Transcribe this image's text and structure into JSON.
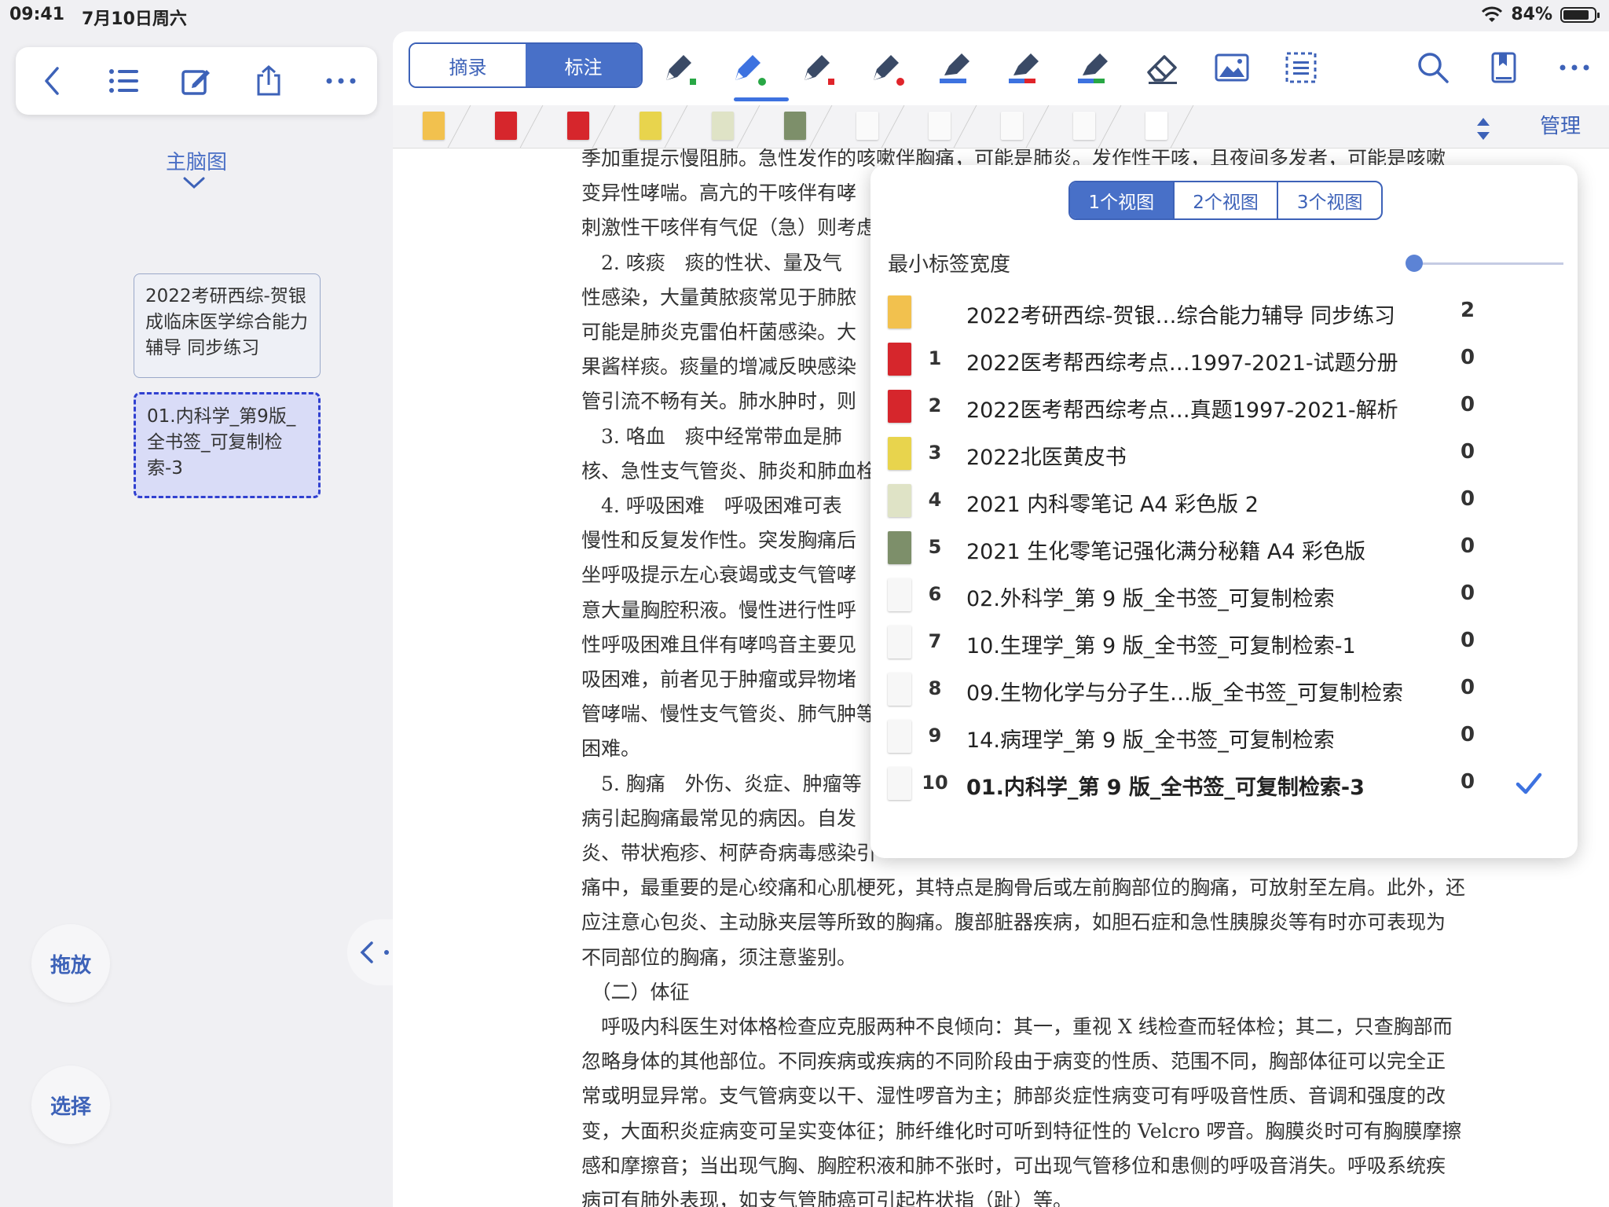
{
  "status_bar": {
    "time": "09:41",
    "date": "7月10日周六",
    "battery": "84%",
    "battery_level": 0.84
  },
  "left_panel": {
    "toolbar_icons": [
      "back-icon",
      "list-icon",
      "edit-icon",
      "share-icon",
      "more-icon"
    ],
    "mindmap_title": "主脑图",
    "cards": [
      {
        "text": "2022考研西综-贺银成临床医学综合能力辅导 同步练习"
      },
      {
        "text": "01.内科学_第9版_全书签_可复制检索-3"
      }
    ],
    "drag_label": "拖放",
    "select_label": "选择"
  },
  "toolbar": {
    "segment": {
      "excerpt": "摘录",
      "annotate": "标注"
    },
    "tools": [
      "pen-black-icon",
      "pen-blue-icon",
      "pen-red-icon",
      "pen-dark-icon",
      "highlighter-blue-icon",
      "highlighter-red-icon",
      "highlighter-green-icon",
      "eraser-icon",
      "image-icon",
      "select-area-icon"
    ],
    "right_icons": [
      "search-icon",
      "bookmark-icon",
      "more-icon"
    ],
    "manage_label": "管理",
    "colors": {
      "accent": "#3d62b8",
      "active": "#4870c8",
      "red": "#e0242a",
      "green": "#28a745"
    }
  },
  "document": {
    "lines": [
      "季加重提示慢阻肺。急性发作的咳嗽伴胸痛，可能是肺炎。发作性干咳，且夜间多发者，可能是咳嗽",
      "变异性哮喘。高亢的干咳伴有哮",
      "刺激性干咳伴有气促（急）则考虑",
      "　2. 咳痰　痰的性状、量及气",
      "性感染，大量黄脓痰常见于肺脓",
      "可能是肺炎克雷伯杆菌感染。大",
      "果酱样痰。痰量的增减反映感染",
      "管引流不畅有关。肺水肿时，则",
      "　3. 咯血　痰中经常带血是肺",
      "核、急性支气管炎、肺炎和肺血栓",
      "　4. 呼吸困难　呼吸困难可表",
      "慢性和反复发作性。突发胸痛后",
      "坐呼吸提示左心衰竭或支气管哮",
      "意大量胸腔积液。慢性进行性呼",
      "性呼吸困难且伴有哮鸣音主要见",
      "吸困难，前者见于肿瘤或异物堵",
      "管哮喘、慢性支气管炎、肺气肿等",
      "困难。",
      "　5. 胸痛　外伤、炎症、肿瘤等",
      "病引起胸痛最常见的病因。自发",
      "炎、带状疱疹、柯萨奇病毒感染引",
      "痛中，最重要的是心绞痛和心肌梗死，其特点是胸骨后或左前胸部位的胸痛，可放射至左肩。此外，还",
      "应注意心包炎、主动脉夹层等所致的胸痛。腹部脏器疾病，如胆石症和急性胰腺炎等有时亦可表现为",
      "不同部位的胸痛，须注意鉴别。",
      "　（二）体征",
      "　呼吸内科医生对体格检查应克服两种不良倾向：其一，重视 X 线检查而轻体检；其二，只查胸部而",
      "忽略身体的其他部位。不同疾病或疾病的不同阶段由于病变的性质、范围不同，胸部体征可以完全正",
      "常或明显异常。支气管病变以干、湿性啰音为主；肺部炎症性病变可有呼吸音性质、音调和强度的改",
      "变，大面积炎症病变可呈实变体征；肺纤维化时可听到特征性的 Velcro 啰音。胸膜炎时可有胸膜摩擦",
      "感和摩擦音；当出现气胸、胸腔积液和肺不张时，可出现气管移位和患侧的呼吸音消失。呼吸系统疾",
      "病可有肺外表现，如支气管肺癌可引起杵状指（趾）等。"
    ]
  },
  "popover": {
    "view_options": [
      "1个视图",
      "2个视图",
      "3个视图"
    ],
    "selected_view": 0,
    "min_tab_width_label": "最小标签宽度",
    "min_tab_width_level": 0,
    "items": [
      {
        "index": "",
        "name": "2022考研西综-贺银…综合能力辅导 同步练习",
        "count": "2",
        "selected": false,
        "thumb": "#f2c14e"
      },
      {
        "index": "1",
        "name": "2022医考帮西综考点…1997-2021-试题分册",
        "count": "0",
        "selected": false,
        "thumb": "#d6262c"
      },
      {
        "index": "2",
        "name": "2022医考帮西综考点…真题1997-2021-解析",
        "count": "0",
        "selected": false,
        "thumb": "#d6262c"
      },
      {
        "index": "3",
        "name": "2022北医黄皮书",
        "count": "0",
        "selected": false,
        "thumb": "#e8d44d"
      },
      {
        "index": "4",
        "name": "2021 内科零笔记 A4 彩色版 2",
        "count": "0",
        "selected": false,
        "thumb": "#dfe3c6"
      },
      {
        "index": "5",
        "name": "2021 生化零笔记强化满分秘籍 A4 彩色版",
        "count": "0",
        "selected": false,
        "thumb": "#7d8f6a"
      },
      {
        "index": "6",
        "name": "02.外科学_第 9 版_全书签_可复制检索",
        "count": "0",
        "selected": false,
        "thumb": "#f7f7f7"
      },
      {
        "index": "7",
        "name": "10.生理学_第 9 版_全书签_可复制检索-1",
        "count": "0",
        "selected": false,
        "thumb": "#f7f7f7"
      },
      {
        "index": "8",
        "name": "09.生物化学与分子生…版_全书签_可复制检索",
        "count": "0",
        "selected": false,
        "thumb": "#f7f7f7"
      },
      {
        "index": "9",
        "name": "14.病理学_第 9 版_全书签_可复制检索",
        "count": "0",
        "selected": false,
        "thumb": "#f7f7f7"
      },
      {
        "index": "10",
        "name": "01.内科学_第 9 版_全书签_可复制检索-3",
        "count": "0",
        "selected": true,
        "thumb": "#f7f7f7"
      }
    ]
  }
}
